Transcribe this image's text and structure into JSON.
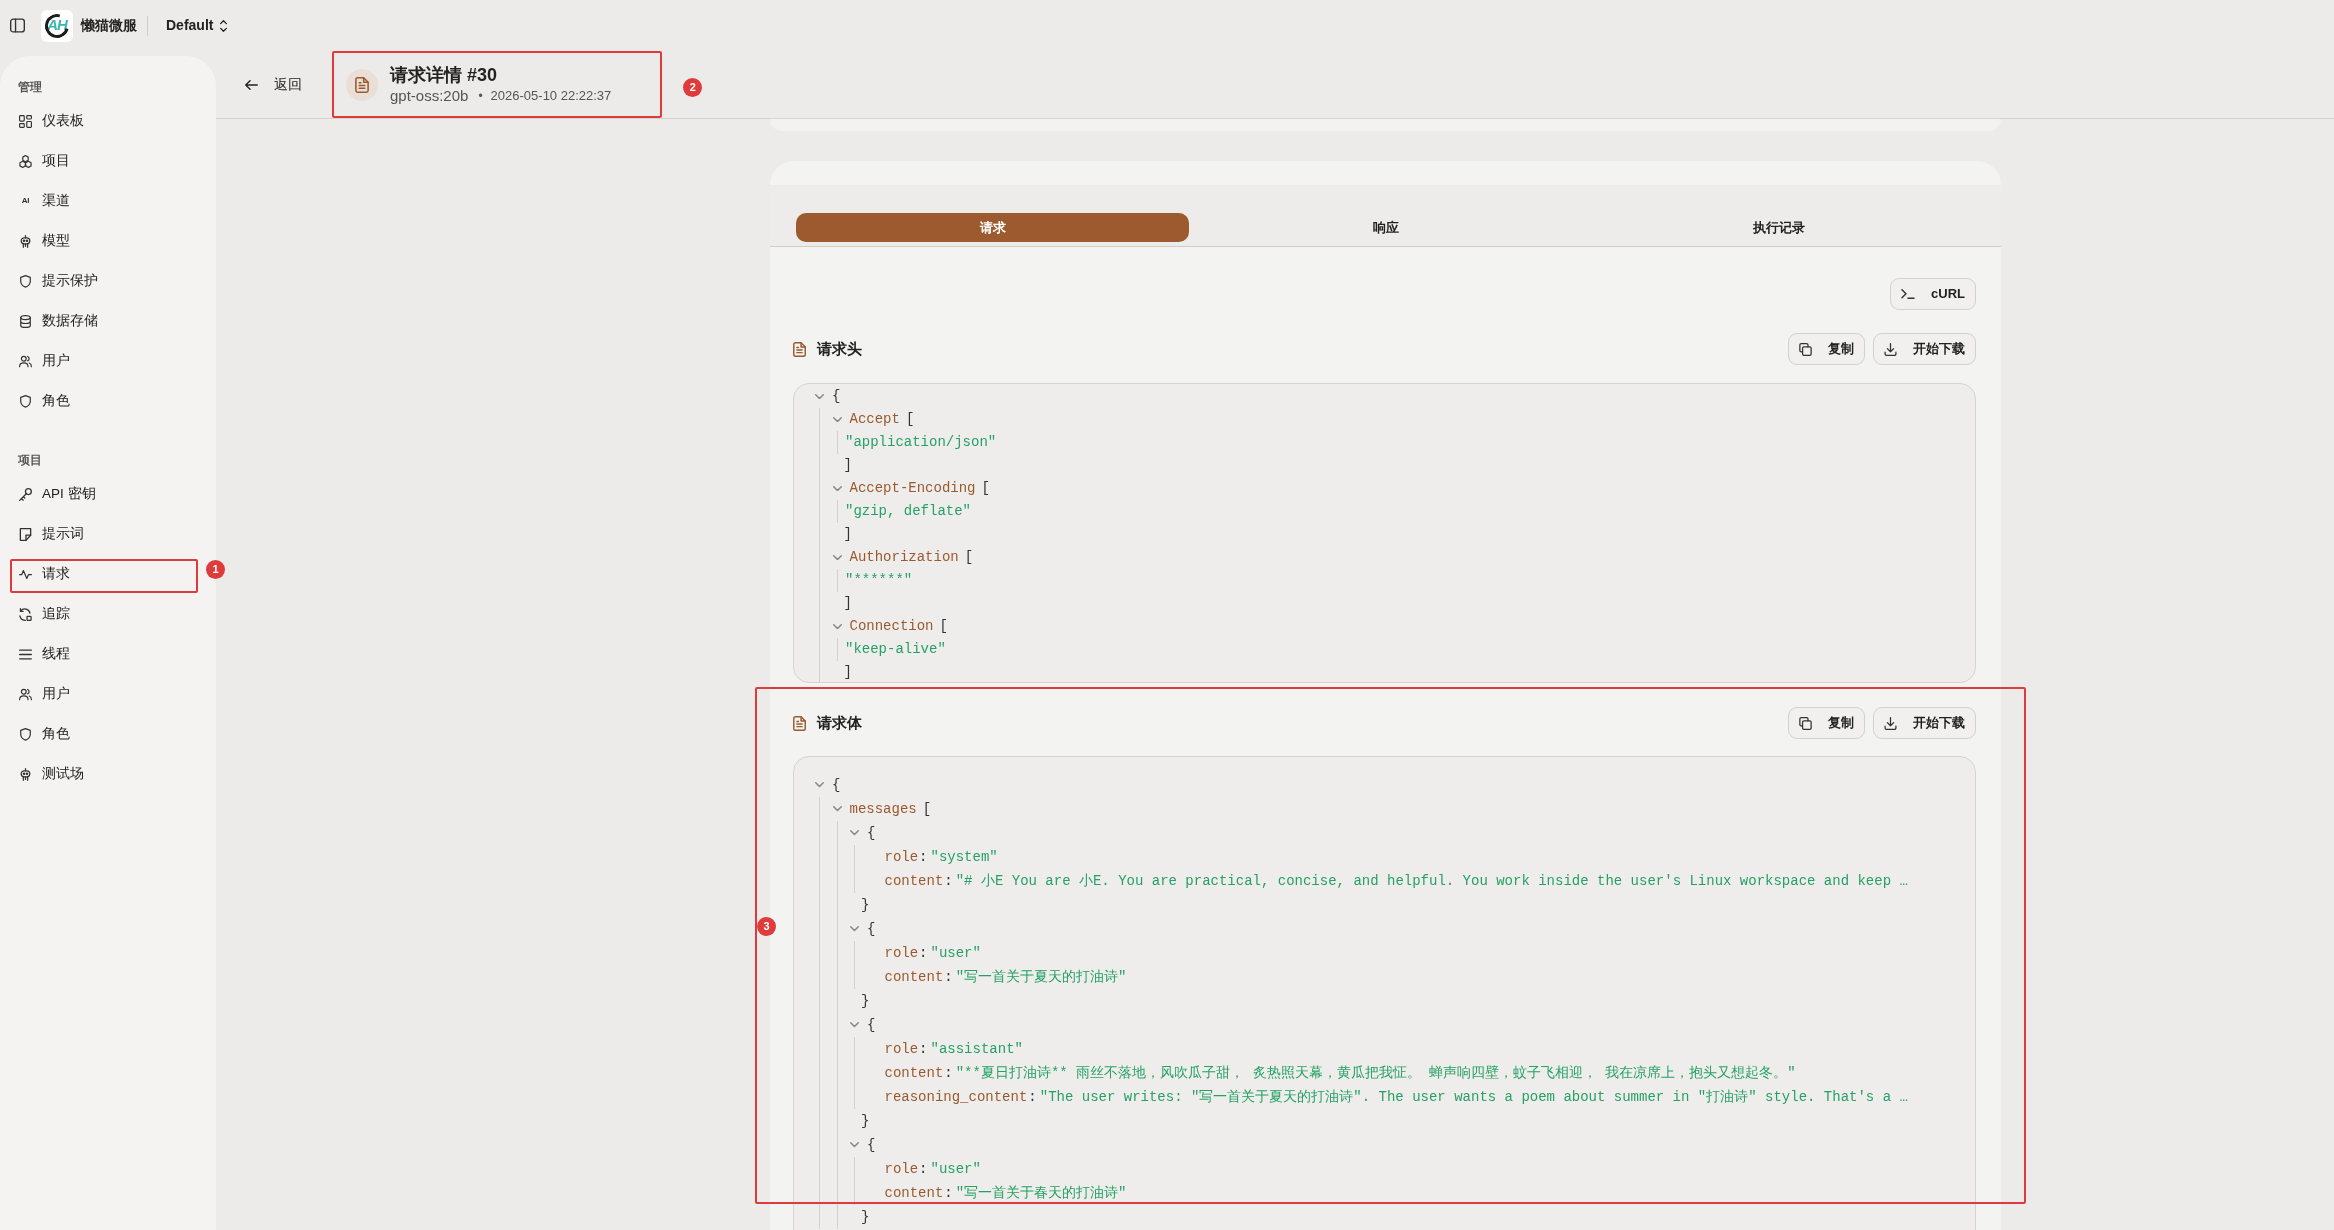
{
  "topbar": {
    "logo_text": "AH",
    "app_name": "懒猫微服",
    "workspace": "Default"
  },
  "sidebar": {
    "sections": [
      {
        "title": "管理",
        "items": [
          {
            "label": "仪表板"
          },
          {
            "label": "项目"
          },
          {
            "label": "渠道",
            "icon_text": "AI"
          },
          {
            "label": "模型"
          },
          {
            "label": "提示保护"
          },
          {
            "label": "数据存储"
          },
          {
            "label": "用户"
          },
          {
            "label": "角色"
          }
        ]
      },
      {
        "title": "项目",
        "items": [
          {
            "label": "API 密钥"
          },
          {
            "label": "提示词"
          },
          {
            "label": "请求",
            "callout": "1"
          },
          {
            "label": "追踪"
          },
          {
            "label": "线程"
          },
          {
            "label": "用户"
          },
          {
            "label": "角色"
          },
          {
            "label": "测试场"
          }
        ]
      }
    ]
  },
  "header": {
    "back": "返回",
    "title": "请求详情 #30",
    "model": "gpt-oss:20b",
    "separator": "•",
    "time": "2026-05-10 22:22:37",
    "callout": "2"
  },
  "tabs": [
    {
      "label": "请求",
      "selected": true
    },
    {
      "label": "响应",
      "selected": false
    },
    {
      "label": "执行记录",
      "selected": false
    }
  ],
  "curl_button": {
    "label": "cURL"
  },
  "request_headers": {
    "title": "请求头",
    "buttons": [
      "复制",
      "开始下载"
    ],
    "tree": {
      "open": "{",
      "expanded": true,
      "children": [
        {
          "key": "Accept",
          "open": "[",
          "expanded": true,
          "children": [
            {
              "value": "\"application/json\""
            }
          ],
          "close": "]"
        },
        {
          "key": "Accept-Encoding",
          "open": "[",
          "expanded": true,
          "children": [
            {
              "value": "\"gzip, deflate\""
            }
          ],
          "close": "]"
        },
        {
          "key": "Authorization",
          "open": "[",
          "expanded": true,
          "children": [
            {
              "value": "\"******\""
            }
          ],
          "close": "]"
        },
        {
          "key": "Connection",
          "open": "[",
          "expanded": true,
          "children": [
            {
              "value": "\"keep-alive\""
            }
          ],
          "close": "]"
        }
      ]
    }
  },
  "request_body": {
    "title": "请求体",
    "buttons": [
      "复制",
      "开始下载"
    ],
    "callout": "3",
    "tree": {
      "open": "{",
      "expanded": true,
      "children": [
        {
          "key": "messages",
          "open": "[",
          "expanded": true,
          "children": [
            {
              "open": "{",
              "expanded": true,
              "children": [
                {
                  "key": "role",
                  "colon": ":",
                  "value": "\"system\""
                },
                {
                  "key": "content",
                  "colon": ":",
                  "value": "\"# 小E You are 小E. You are practical, concise, and helpful. You work inside the user's Linux workspace and keep …"
                }
              ],
              "close": "}"
            },
            {
              "open": "{",
              "expanded": true,
              "children": [
                {
                  "key": "role",
                  "colon": ":",
                  "value": "\"user\""
                },
                {
                  "key": "content",
                  "colon": ":",
                  "value": "\"写一首关于夏天的打油诗\""
                }
              ],
              "close": "}"
            },
            {
              "open": "{",
              "expanded": true,
              "children": [
                {
                  "key": "role",
                  "colon": ":",
                  "value": "\"assistant\""
                },
                {
                  "key": "content",
                  "colon": ":",
                  "value": "\"**夏日打油诗** 雨丝不落地，风吹瓜子甜， 炙热照天幕，黄瓜把我怔。 蝉声响四壁，蚊子飞相迎， 我在凉席上，抱头又想起冬。\""
                },
                {
                  "key": "reasoning_content",
                  "colon": ":",
                  "value": "\"The user writes: \"写一首关于夏天的打油诗\". The user wants a poem about summer in \"打油诗\" style. That's a …"
                }
              ],
              "close": "}"
            },
            {
              "open": "{",
              "expanded": true,
              "children": [
                {
                  "key": "role",
                  "colon": ":",
                  "value": "\"user\""
                },
                {
                  "key": "content",
                  "colon": ":",
                  "value": "\"写一首关于春天的打油诗\""
                }
              ],
              "close": "}"
            }
          ]
        }
      ]
    }
  }
}
